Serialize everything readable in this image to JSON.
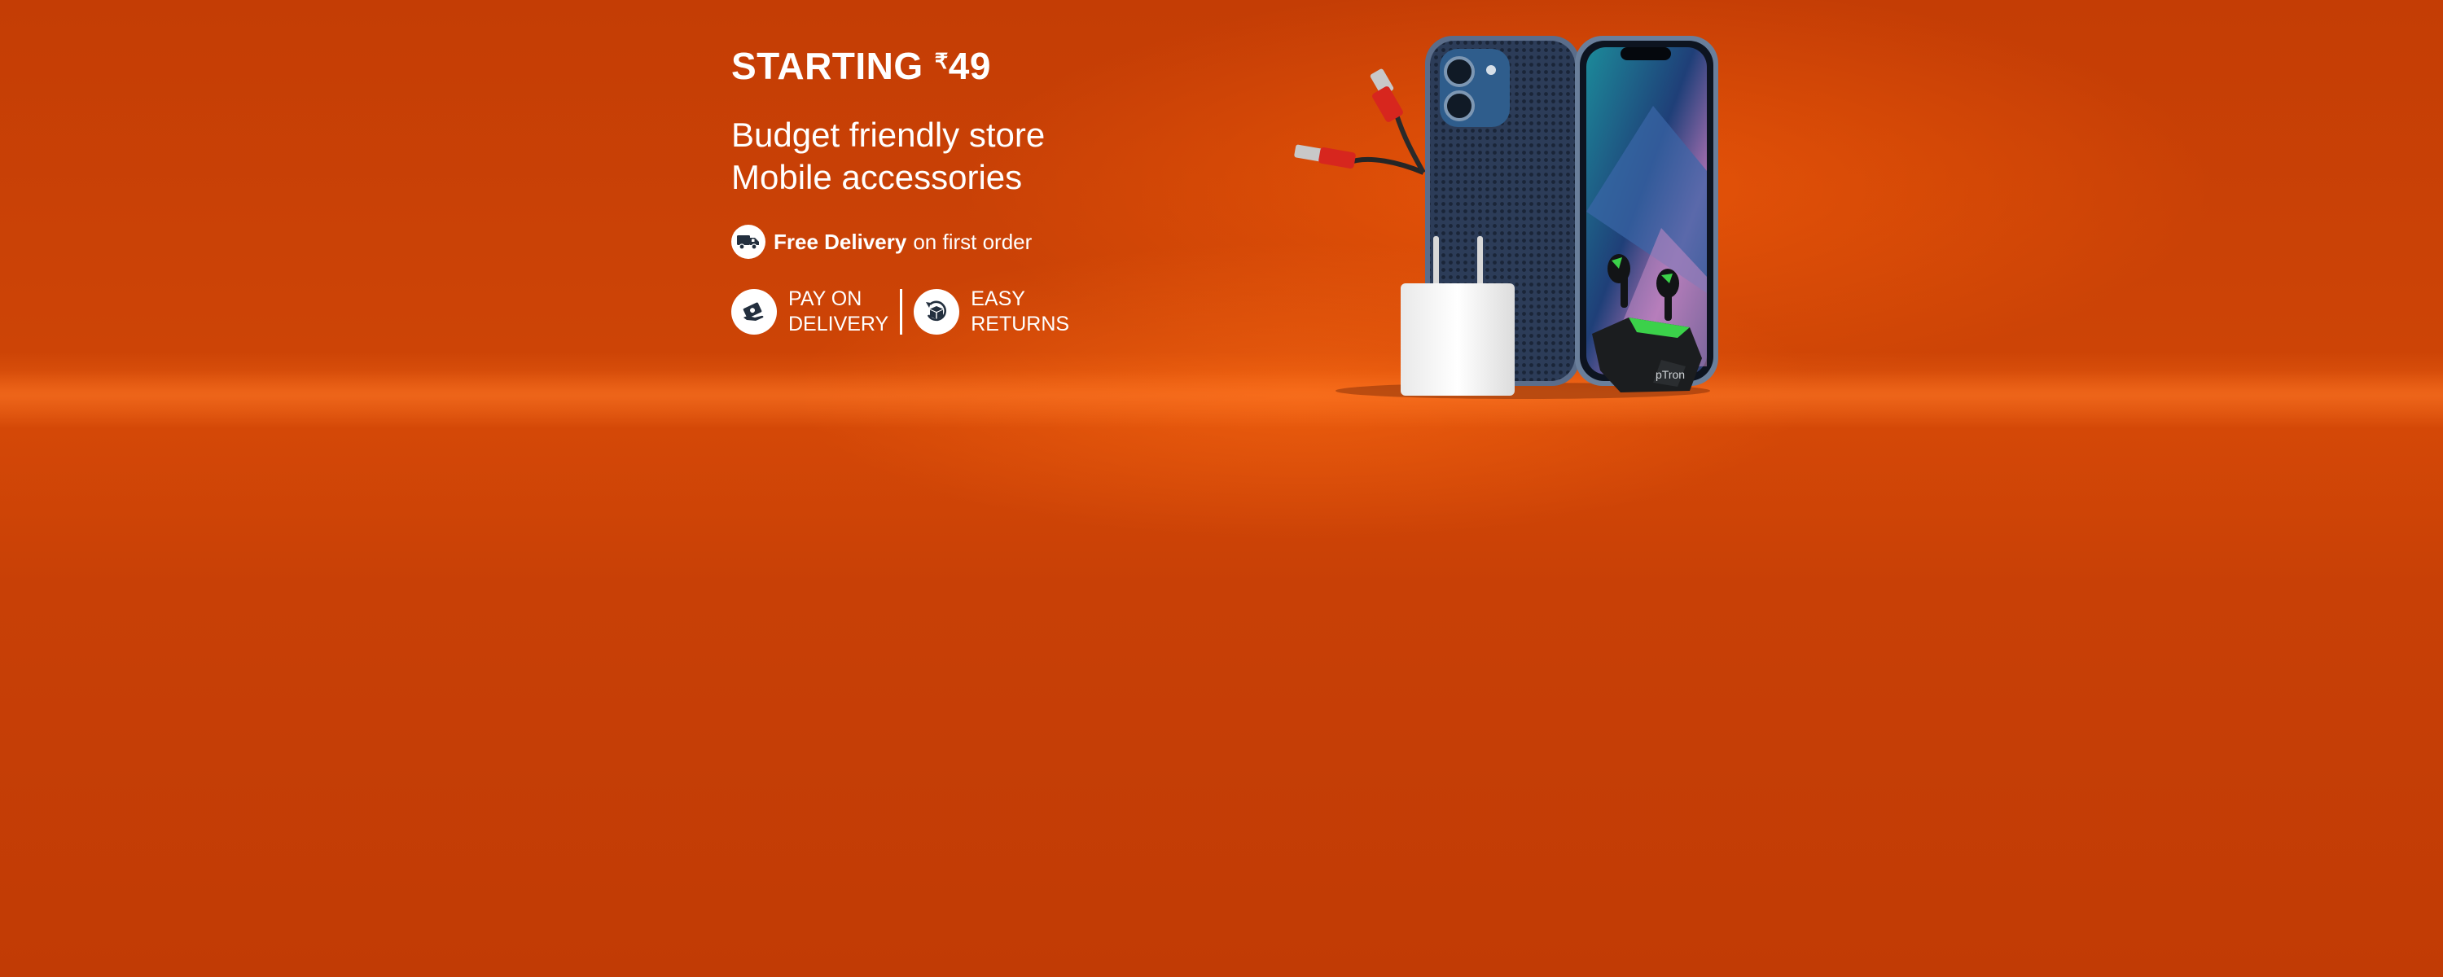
{
  "banner": {
    "price_prefix": "STARTING",
    "currency_symbol": "₹",
    "price_value": "49",
    "headline_line1": "Budget friendly store",
    "headline_line2": "Mobile accessories",
    "delivery_bold": "Free Delivery",
    "delivery_rest": "on first order",
    "features": [
      {
        "line1": "PAY ON",
        "line2": "DELIVERY",
        "icon": "cash-hand-icon"
      },
      {
        "line1": "EASY",
        "line2": "RETURNS",
        "icon": "return-box-icon"
      }
    ],
    "product_brand_text": "pTron"
  },
  "colors": {
    "background": "#c43d05",
    "highlight": "#e0560e",
    "text": "#ffffff"
  }
}
